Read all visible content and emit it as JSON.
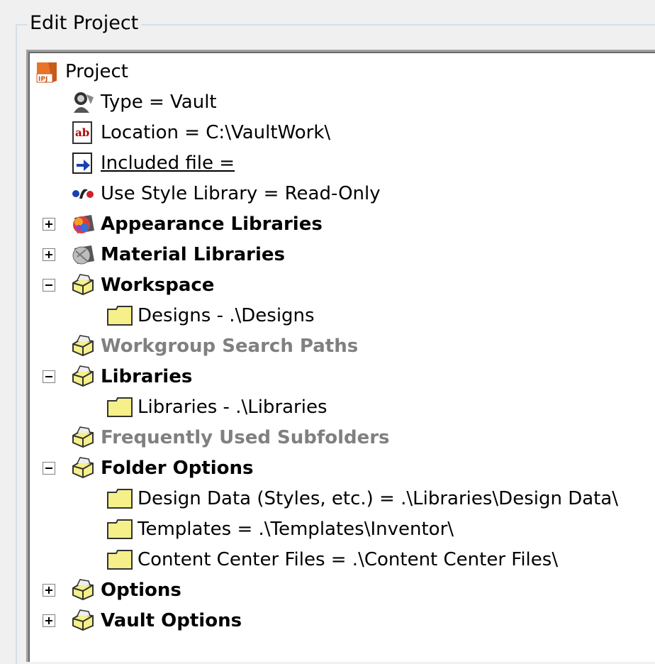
{
  "group": {
    "title": "Edit Project"
  },
  "tree": {
    "root": {
      "label": "Project",
      "icon": "ipj-project-icon"
    },
    "properties": [
      {
        "label": "Type = Vault",
        "icon": "vault-user-icon"
      },
      {
        "label": "Location = C:\\VaultWork\\",
        "icon": "text-field-ab-icon"
      },
      {
        "label": "Included file = ",
        "icon": "included-file-icon"
      },
      {
        "label": "Use Style Library = Read-Only",
        "icon": "style-library-icon"
      }
    ],
    "appearance": {
      "label": "Appearance Libraries",
      "expanded": false
    },
    "material": {
      "label": "Material Libraries",
      "expanded": false
    },
    "workspace": {
      "label": "Workspace",
      "expanded": true,
      "child": "Designs - .\\Designs"
    },
    "workgroup": {
      "label": "Workgroup Search Paths"
    },
    "libraries": {
      "label": "Libraries",
      "expanded": true,
      "child": "Libraries - .\\Libraries"
    },
    "frequent": {
      "label": "Frequently Used Subfolders"
    },
    "folder_options": {
      "label": "Folder Options",
      "expanded": true,
      "children": [
        "Design Data (Styles, etc.) = .\\Libraries\\Design Data\\",
        "Templates = .\\Templates\\Inventor\\",
        "Content Center Files = .\\Content Center Files\\"
      ]
    },
    "options": {
      "label": "Options",
      "expanded": false
    },
    "vault_options": {
      "label": "Vault Options",
      "expanded": false
    },
    "colors": {
      "folder_fill": "#f5f08a",
      "disabled_text": "#808080"
    }
  }
}
